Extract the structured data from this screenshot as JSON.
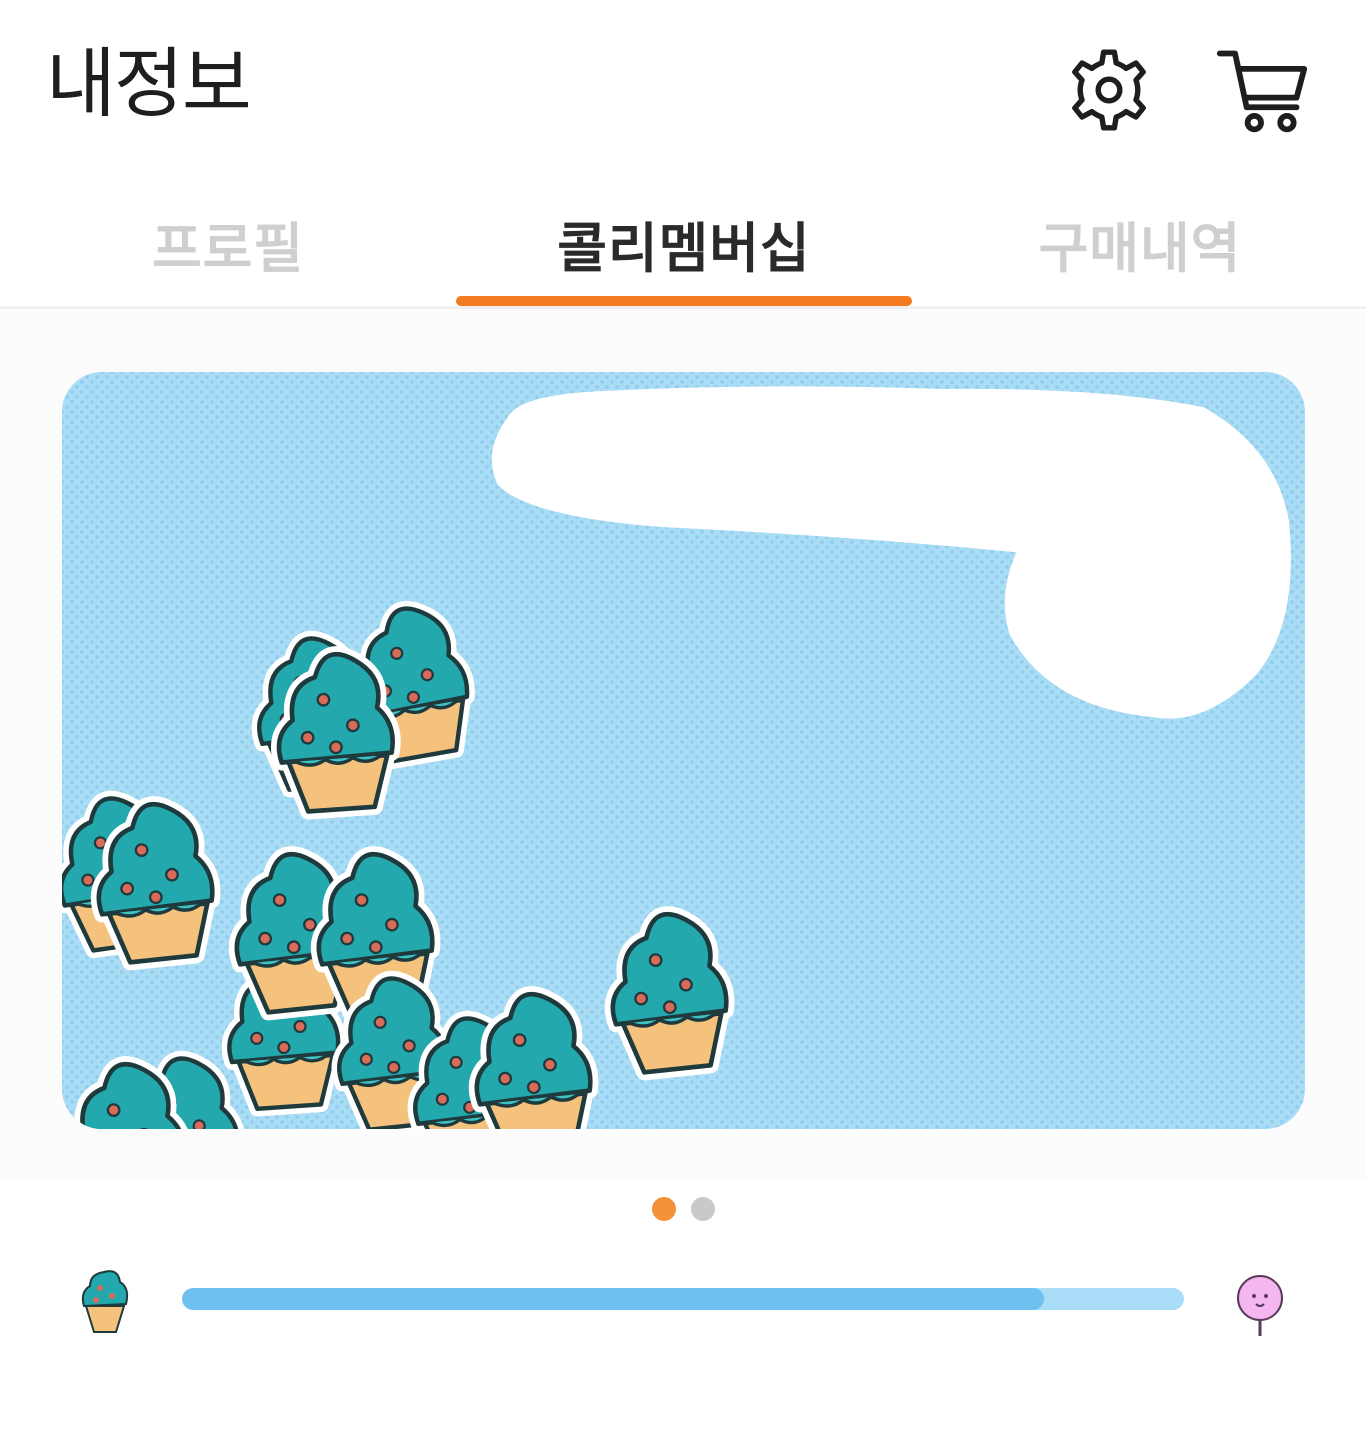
{
  "header": {
    "title": "내정보",
    "settings_icon": "gear-icon",
    "cart_icon": "cart-icon"
  },
  "tabs": [
    {
      "label": "프로필",
      "active": false
    },
    {
      "label": "콜리멤버십",
      "active": true
    },
    {
      "label": "구매내역",
      "active": false
    }
  ],
  "colors": {
    "accent": "#f47b20",
    "tab_inactive": "#cfcfcf",
    "tab_active": "#2a2a2a",
    "card_bg": "#a9dcf5",
    "mint": "#23a9ad",
    "cone": "#f5c27d",
    "progress_fill": "#6ec0f0",
    "progress_track": "#a9dcf7",
    "dot_active": "#f4923a",
    "dot_inactive": "#c9c9c9"
  },
  "membership_card": {
    "illustration": "mint-ice-cream-stickers",
    "redaction": "white-scribble"
  },
  "carousel": {
    "current_page": 1,
    "total_pages": 2
  },
  "progress": {
    "value_fraction": 0.86,
    "start_icon": "mint-ice-cream-icon",
    "end_icon": "pink-cotton-candy-icon"
  }
}
